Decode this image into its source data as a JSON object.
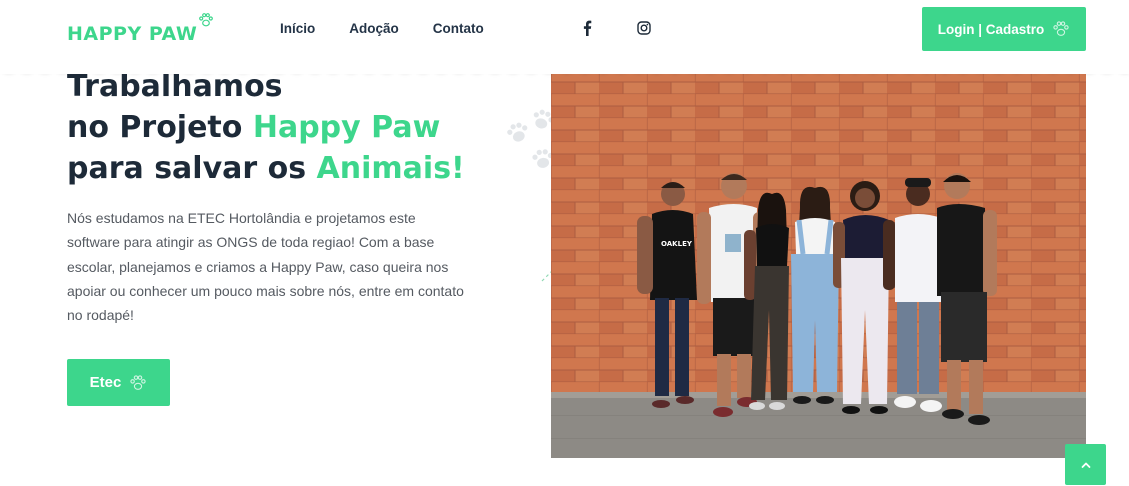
{
  "header": {
    "logo_text": "HAPPY PAW",
    "nav": [
      {
        "label": "Início"
      },
      {
        "label": "Adoção"
      },
      {
        "label": "Contato"
      }
    ],
    "social_icons": [
      "facebook-icon",
      "instagram-icon"
    ],
    "login_label": "Login | Cadastro"
  },
  "hero": {
    "headline_line1": "Trabalhamos",
    "headline_line2_prefix": "no Projeto ",
    "headline_line2_accent": "Happy Paw",
    "headline_line3_prefix": "para salvar os ",
    "headline_line3_accent": "Animais!",
    "paragraph": "Nós estudamos na ETEC Hortolândia e projetamos este software para atingir as ONGS de toda regiao! Com a base escolar, planejamos e criamos a Happy Paw, caso queira nos apoiar ou conhecer um pouco mais sobre nós, entre em contato no rodapé!",
    "button_label": "Etec",
    "photo_tshirt_text": "OAKLEY"
  },
  "colors": {
    "accent": "#3dd68c",
    "heading": "#1d2a38",
    "body_text": "#555a61",
    "brick": "#c4693f"
  },
  "icons": {
    "button_icon": "paw-outline-icon",
    "back_to_top": "chevron-up-icon"
  }
}
